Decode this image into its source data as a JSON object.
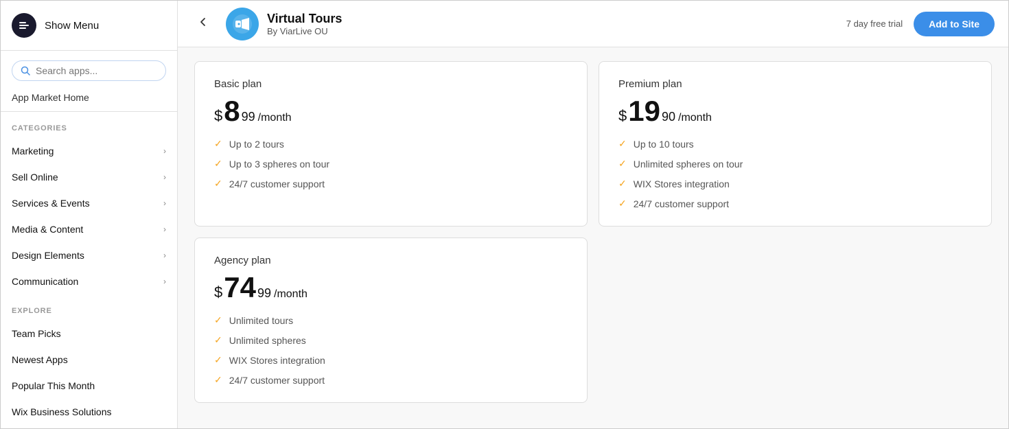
{
  "sidebar": {
    "show_menu_label": "Show Menu",
    "search_placeholder": "Search apps...",
    "app_market_home_label": "App Market Home",
    "categories_label": "CATEGORIES",
    "nav_items": [
      {
        "label": "Marketing",
        "has_chevron": true
      },
      {
        "label": "Sell Online",
        "has_chevron": true
      },
      {
        "label": "Services & Events",
        "has_chevron": true
      },
      {
        "label": "Media & Content",
        "has_chevron": true
      },
      {
        "label": "Design Elements",
        "has_chevron": true
      },
      {
        "label": "Communication",
        "has_chevron": true
      }
    ],
    "explore_label": "EXPLORE",
    "explore_items": [
      {
        "label": "Team Picks"
      },
      {
        "label": "Newest Apps"
      },
      {
        "label": "Popular This Month"
      },
      {
        "label": "Wix Business Solutions"
      }
    ]
  },
  "header": {
    "back_label": "←",
    "app_title": "Virtual Tours",
    "app_subtitle": "By ViarLive OU",
    "free_trial": "7 day free trial",
    "add_to_site": "Add to Site"
  },
  "plans": [
    {
      "id": "basic",
      "name": "Basic plan",
      "price_dollar": "$",
      "price_amount": "8",
      "price_cents": "99",
      "price_period": "/month",
      "features": [
        "Up to 2 tours",
        "Up to 3 spheres on tour",
        "24/7 customer support"
      ]
    },
    {
      "id": "premium",
      "name": "Premium plan",
      "price_dollar": "$",
      "price_amount": "19",
      "price_cents": "90",
      "price_period": "/month",
      "features": [
        "Up to 10 tours",
        "Unlimited spheres on tour",
        "WIX Stores integration",
        "24/7 customer support"
      ]
    },
    {
      "id": "agency",
      "name": "Agency plan",
      "price_dollar": "$",
      "price_amount": "74",
      "price_cents": "99",
      "price_period": "/month",
      "features": [
        "Unlimited tours",
        "Unlimited spheres",
        "WIX Stores integration",
        "24/7 customer support"
      ]
    }
  ],
  "icons": {
    "show_menu": "→|",
    "check": "✓",
    "chevron_right": "›"
  }
}
